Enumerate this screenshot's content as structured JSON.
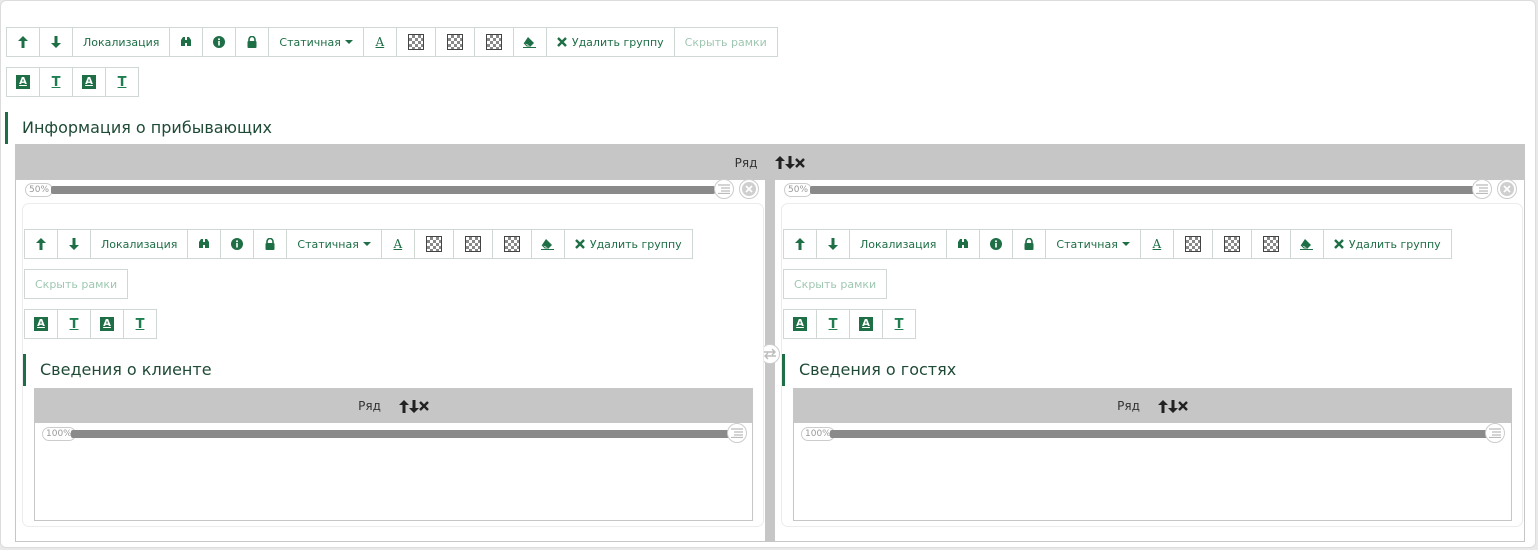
{
  "toolbar": {
    "localization": "Локализация",
    "static": "Статичная",
    "delete_group": "Удалить группу",
    "hide_frames": "Скрыть рамки"
  },
  "main_section": {
    "title": "Информация о прибывающих",
    "row_label": "Ряд"
  },
  "columns": [
    {
      "width_label": "50%",
      "section_title": "Сведения о клиенте",
      "row_label": "Ряд",
      "inner_width_label": "100%"
    },
    {
      "width_label": "50%",
      "section_title": "Сведения о гостях",
      "row_label": "Ряд",
      "inner_width_label": "100%"
    }
  ],
  "icons": {
    "move_up": "arrow-up-icon",
    "move_down": "arrow-down-icon",
    "search": "binoculars-icon",
    "info": "info-icon",
    "lock": "lock-icon",
    "text_color": "font-color-icon",
    "pattern": "checker-pattern-icon",
    "eraser": "eraser-icon",
    "delete": "close-icon"
  },
  "colors": {
    "accent": "#1e6e46",
    "row_bar": "#c6c6c6"
  }
}
